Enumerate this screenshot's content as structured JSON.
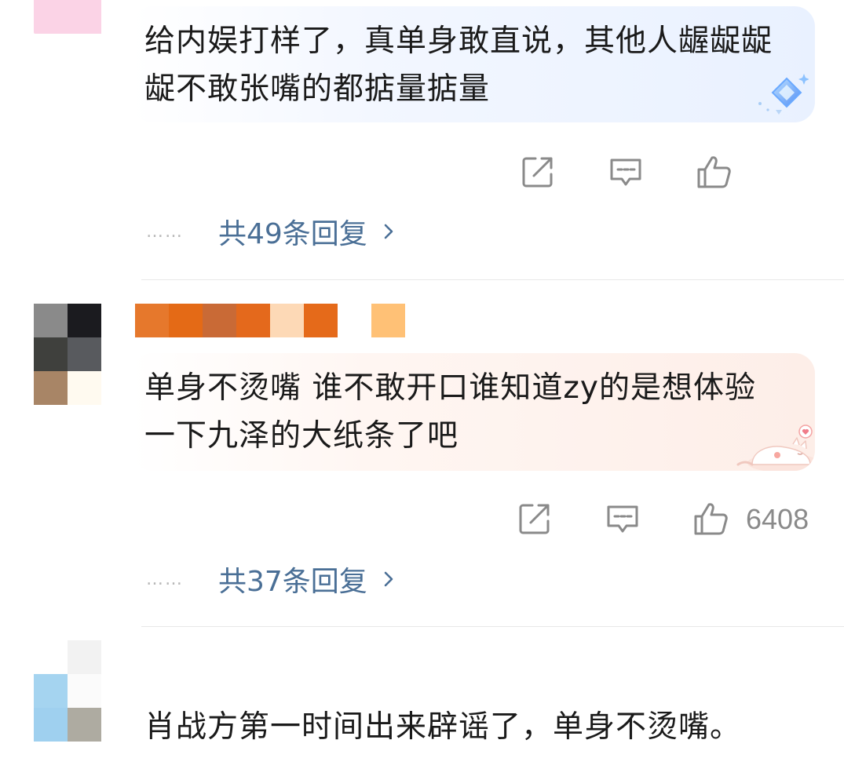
{
  "comments": [
    {
      "text": "给内娱打样了，真单身敢直说，其他人龌龊龊龊不敢张嘴的都掂量掂量",
      "like_count": "",
      "replies_label": "共49条回复",
      "replies_dots": "……",
      "bubble_theme": "blue"
    },
    {
      "text": "单身不烫嘴 谁不敢开口谁知道zy的是想体验一下九泽的大纸条了吧",
      "like_count": "6408",
      "replies_label": "共37条回复",
      "replies_dots": "……",
      "bubble_theme": "peach"
    },
    {
      "text": "肖战方第一时间出来辟谣了，单身不烫嘴。"
    }
  ],
  "icons": {
    "share": "share-icon",
    "comment": "comment-icon",
    "like": "like-icon",
    "chevron": "chevron-right-icon"
  },
  "colors": {
    "reply_link": "#4a6f96",
    "icon_gray": "#8a8a8a",
    "text": "#1a1a1a",
    "divider": "#e8e8e8"
  }
}
